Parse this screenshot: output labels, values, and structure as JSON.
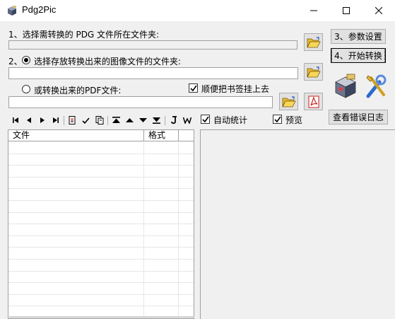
{
  "window": {
    "title": "Pdg2Pic",
    "icon": "pdg2pic-app-icon",
    "controls": [
      "minimize-icon",
      "maximize-icon",
      "close-icon"
    ]
  },
  "source": {
    "label_num": "1、",
    "label": "选择需转换的 PDG 文件所在文件夹:",
    "value": ""
  },
  "output_folder": {
    "label_num": "2、",
    "label": "选择存放转换出来的图像文件的文件夹:",
    "value": "",
    "selected": true
  },
  "pdf_output": {
    "label": "或转换出来的PDF文件:",
    "value": "",
    "selected": false
  },
  "bookmark_option": {
    "label": "顺便把书签挂上去",
    "checked": true
  },
  "buttons": {
    "params": "3、参数设置",
    "start": "4、开始转换",
    "error_log": "查看错误日志"
  },
  "options": {
    "auto_stats": {
      "label": "自动统计",
      "checked": true
    },
    "preview": {
      "label": "预览",
      "checked": true
    }
  },
  "list": {
    "columns": [
      "文件",
      "格式"
    ],
    "rows": []
  },
  "icons": {
    "browse": "folder-open-icon",
    "pdf": "pdf-icon",
    "package": "package-icon",
    "tools": "tools-icon"
  },
  "toolbar_icons": [
    "first-icon",
    "prev-icon",
    "next-icon",
    "last-icon",
    "page-icon",
    "check-icon",
    "copy-icon",
    "move-top-icon",
    "move-up-icon",
    "move-down-icon",
    "move-bottom-icon",
    "j-icon",
    "w-icon"
  ],
  "colors": {
    "window_bg": "#f0f0f0",
    "titlebar_bg": "#ffffff",
    "button_face": "#e1e1e1",
    "border": "#adadad",
    "folder_yellow": "#f0c020",
    "pdf_red": "#cc2020"
  }
}
